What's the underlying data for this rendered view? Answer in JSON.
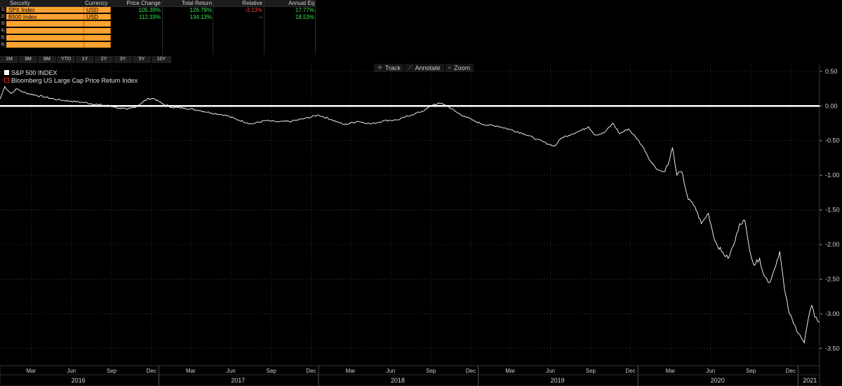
{
  "table": {
    "headers": [
      "Security",
      "Currency",
      "Price Change",
      "Total Return",
      "Relative",
      "Annual Eq"
    ],
    "rows": [
      {
        "num": "1)",
        "security": "SPX Index",
        "currency": "USD",
        "price_change": "105.39%",
        "total_return": "126.79%",
        "relative": "-3.13%",
        "annual_eq": "17.77%"
      },
      {
        "num": "2)",
        "security": "B500 Index",
        "currency": "USD",
        "price_change": "112.33%",
        "total_return": "134.13%",
        "relative": "--",
        "annual_eq": "18.53%"
      },
      {
        "num": "3)",
        "security": "",
        "currency": "",
        "price_change": "",
        "total_return": "",
        "relative": "",
        "annual_eq": ""
      },
      {
        "num": "4)",
        "security": "",
        "currency": "",
        "price_change": "",
        "total_return": "",
        "relative": "",
        "annual_eq": ""
      },
      {
        "num": "5)",
        "security": "",
        "currency": "",
        "price_change": "",
        "total_return": "",
        "relative": "",
        "annual_eq": ""
      },
      {
        "num": "6)",
        "security": "",
        "currency": "",
        "price_change": "",
        "total_return": "",
        "relative": "",
        "annual_eq": ""
      }
    ]
  },
  "periods": [
    "1M",
    "3M",
    "6M",
    "YTD",
    "1Y",
    "2Y",
    "3Y",
    "5Y",
    "10Y"
  ],
  "toolbar": [
    {
      "label": "Track",
      "icon": "crosshair-icon"
    },
    {
      "label": "Annotate",
      "icon": "pencil-icon"
    },
    {
      "label": "Zoom",
      "icon": "magnifier-icon"
    }
  ],
  "colors": {
    "background": "#000000",
    "line": "#ffffff",
    "orange_cell": "#ffa231",
    "positive": "#2ee64b",
    "negative": "#ff3b30",
    "legend_outline": "#d02020"
  },
  "chart_data": {
    "type": "line",
    "legend": [
      {
        "name": "S&P 500 INDEX",
        "swatch": "filled",
        "color": "#ffffff"
      },
      {
        "name": "Bloomberg US Large Cap Price Return Index",
        "swatch": "outline",
        "color": "#d02020"
      }
    ],
    "ylim": [
      -3.75,
      0.6
    ],
    "yticks": [
      "0.50",
      "0.00",
      "-0.50",
      "-1.00",
      "-1.50",
      "-2.00",
      "-2.50",
      "-3.00",
      "-3.50"
    ],
    "ytick_values": [
      0.5,
      0.0,
      -0.5,
      -1.0,
      -1.5,
      -2.0,
      -2.5,
      -3.0,
      -3.5
    ],
    "xlim": [
      "2016-01-04",
      "2021-02-19"
    ],
    "month_ticks": [
      {
        "label": "Mar",
        "date": "2016-03-15"
      },
      {
        "label": "Jun",
        "date": "2016-06-15"
      },
      {
        "label": "Sep",
        "date": "2016-09-15"
      },
      {
        "label": "Dec",
        "date": "2016-12-15"
      },
      {
        "label": "Mar",
        "date": "2017-03-15"
      },
      {
        "label": "Jun",
        "date": "2017-06-15"
      },
      {
        "label": "Sep",
        "date": "2017-09-15"
      },
      {
        "label": "Dec",
        "date": "2017-12-15"
      },
      {
        "label": "Mar",
        "date": "2018-03-15"
      },
      {
        "label": "Jun",
        "date": "2018-06-15"
      },
      {
        "label": "Sep",
        "date": "2018-09-15"
      },
      {
        "label": "Dec",
        "date": "2018-12-15"
      },
      {
        "label": "Mar",
        "date": "2019-03-15"
      },
      {
        "label": "Jun",
        "date": "2019-06-15"
      },
      {
        "label": "Sep",
        "date": "2019-09-15"
      },
      {
        "label": "Dec",
        "date": "2019-12-15"
      },
      {
        "label": "Mar",
        "date": "2020-03-15"
      },
      {
        "label": "Jun",
        "date": "2020-06-15"
      },
      {
        "label": "Sep",
        "date": "2020-09-15"
      },
      {
        "label": "Dec",
        "date": "2020-12-15"
      }
    ],
    "year_labels": [
      {
        "label": "2016",
        "date": "2016-07-01"
      },
      {
        "label": "2017",
        "date": "2017-07-01"
      },
      {
        "label": "2018",
        "date": "2018-07-01"
      },
      {
        "label": "2019",
        "date": "2019-07-01"
      },
      {
        "label": "2020",
        "date": "2020-07-01"
      },
      {
        "label": "2021",
        "date": "2021-01-28"
      }
    ],
    "year_starts": [
      "2017-01-01",
      "2018-01-01",
      "2019-01-01",
      "2020-01-01",
      "2021-01-01"
    ],
    "reference_line": 0.0,
    "series": [
      {
        "name": "S&P 500 INDEX",
        "points": [
          [
            "2016-01-04",
            0.1
          ],
          [
            "2016-01-15",
            0.28
          ],
          [
            "2016-01-29",
            0.18
          ],
          [
            "2016-02-12",
            0.25
          ],
          [
            "2016-02-26",
            0.2
          ],
          [
            "2016-03-15",
            0.17
          ],
          [
            "2016-04-15",
            0.13
          ],
          [
            "2016-05-15",
            0.09
          ],
          [
            "2016-06-15",
            0.07
          ],
          [
            "2016-07-15",
            0.05
          ],
          [
            "2016-08-15",
            0.02
          ],
          [
            "2016-09-15",
            0.0
          ],
          [
            "2016-10-01",
            -0.03
          ],
          [
            "2016-10-20",
            -0.05
          ],
          [
            "2016-11-05",
            -0.02
          ],
          [
            "2016-11-20",
            0.03
          ],
          [
            "2016-12-05",
            0.1
          ],
          [
            "2016-12-20",
            0.11
          ],
          [
            "2017-01-10",
            0.03
          ],
          [
            "2017-02-01",
            -0.02
          ],
          [
            "2017-03-01",
            -0.03
          ],
          [
            "2017-04-01",
            -0.06
          ],
          [
            "2017-05-01",
            -0.1
          ],
          [
            "2017-06-01",
            -0.13
          ],
          [
            "2017-07-01",
            -0.2
          ],
          [
            "2017-08-01",
            -0.26
          ],
          [
            "2017-09-01",
            -0.21
          ],
          [
            "2017-10-01",
            -0.23
          ],
          [
            "2017-11-01",
            -0.22
          ],
          [
            "2017-12-01",
            -0.18
          ],
          [
            "2018-01-01",
            -0.13
          ],
          [
            "2018-02-01",
            -0.2
          ],
          [
            "2018-03-01",
            -0.27
          ],
          [
            "2018-04-01",
            -0.22
          ],
          [
            "2018-05-01",
            -0.26
          ],
          [
            "2018-06-01",
            -0.21
          ],
          [
            "2018-07-01",
            -0.2
          ],
          [
            "2018-08-01",
            -0.13
          ],
          [
            "2018-09-01",
            -0.06
          ],
          [
            "2018-09-20",
            0.02
          ],
          [
            "2018-10-10",
            0.04
          ],
          [
            "2018-10-25",
            -0.01
          ],
          [
            "2018-11-15",
            -0.1
          ],
          [
            "2018-12-01",
            -0.15
          ],
          [
            "2018-12-24",
            -0.22
          ],
          [
            "2019-01-15",
            -0.27
          ],
          [
            "2019-02-15",
            -0.29
          ],
          [
            "2019-03-15",
            -0.34
          ],
          [
            "2019-04-15",
            -0.4
          ],
          [
            "2019-05-15",
            -0.48
          ],
          [
            "2019-06-10",
            -0.55
          ],
          [
            "2019-06-25",
            -0.58
          ],
          [
            "2019-07-10",
            -0.46
          ],
          [
            "2019-08-05",
            -0.4
          ],
          [
            "2019-08-25",
            -0.35
          ],
          [
            "2019-09-10",
            -0.3
          ],
          [
            "2019-09-25",
            -0.42
          ],
          [
            "2019-10-15",
            -0.39
          ],
          [
            "2019-11-05",
            -0.25
          ],
          [
            "2019-11-20",
            -0.4
          ],
          [
            "2019-12-10",
            -0.33
          ],
          [
            "2019-12-31",
            -0.48
          ],
          [
            "2020-01-15",
            -0.62
          ],
          [
            "2020-01-30",
            -0.8
          ],
          [
            "2020-02-15",
            -0.92
          ],
          [
            "2020-02-28",
            -0.95
          ],
          [
            "2020-03-10",
            -0.85
          ],
          [
            "2020-03-20",
            -0.6
          ],
          [
            "2020-03-30",
            -1.0
          ],
          [
            "2020-04-10",
            -0.95
          ],
          [
            "2020-04-25",
            -1.35
          ],
          [
            "2020-05-10",
            -1.45
          ],
          [
            "2020-05-25",
            -1.7
          ],
          [
            "2020-06-10",
            -1.55
          ],
          [
            "2020-06-25",
            -1.95
          ],
          [
            "2020-07-10",
            -2.1
          ],
          [
            "2020-07-25",
            -2.2
          ],
          [
            "2020-08-10",
            -1.95
          ],
          [
            "2020-08-20",
            -1.7
          ],
          [
            "2020-09-01",
            -1.65
          ],
          [
            "2020-09-10",
            -2.0
          ],
          [
            "2020-09-22",
            -2.3
          ],
          [
            "2020-10-05",
            -2.2
          ],
          [
            "2020-10-15",
            -2.45
          ],
          [
            "2020-10-28",
            -2.55
          ],
          [
            "2020-11-08",
            -2.35
          ],
          [
            "2020-11-20",
            -2.1
          ],
          [
            "2020-12-01",
            -2.65
          ],
          [
            "2020-12-10",
            -2.95
          ],
          [
            "2020-12-22",
            -3.15
          ],
          [
            "2021-01-05",
            -3.3
          ],
          [
            "2021-01-15",
            -3.42
          ],
          [
            "2021-01-25",
            -3.05
          ],
          [
            "2021-02-01",
            -2.88
          ],
          [
            "2021-02-08",
            -3.05
          ],
          [
            "2021-02-19",
            -3.12
          ]
        ]
      }
    ]
  }
}
